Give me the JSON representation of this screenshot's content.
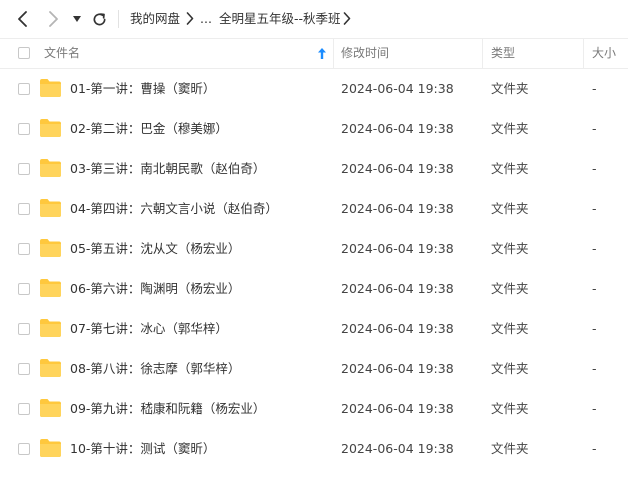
{
  "nav": {
    "back_icon": "chevron-left-icon",
    "forward_icon": "chevron-right-icon",
    "dropdown_icon": "caret-down-icon",
    "refresh_icon": "refresh-icon",
    "breadcrumb": {
      "root": "我的网盘",
      "ellipsis": "...",
      "current": "全明星五年级--秋季班"
    }
  },
  "columns": {
    "name": "文件名",
    "modified": "修改时间",
    "type": "类型",
    "size": "大小",
    "sort_icon": "sort-ascending-icon"
  },
  "accent_color": "#1a8cff",
  "folder_color": "#ffc83d",
  "files": [
    {
      "name": "01-第一讲：曹操（窦昕）",
      "modified": "2024-06-04 19:38",
      "type": "文件夹",
      "size": "-"
    },
    {
      "name": "02-第二讲：巴金（穆美娜）",
      "modified": "2024-06-04 19:38",
      "type": "文件夹",
      "size": "-"
    },
    {
      "name": "03-第三讲：南北朝民歌（赵伯奇）",
      "modified": "2024-06-04 19:38",
      "type": "文件夹",
      "size": "-"
    },
    {
      "name": "04-第四讲：六朝文言小说（赵伯奇）",
      "modified": "2024-06-04 19:38",
      "type": "文件夹",
      "size": "-"
    },
    {
      "name": "05-第五讲：沈从文（杨宏业）",
      "modified": "2024-06-04 19:38",
      "type": "文件夹",
      "size": "-"
    },
    {
      "name": "06-第六讲：陶渊明（杨宏业）",
      "modified": "2024-06-04 19:38",
      "type": "文件夹",
      "size": "-"
    },
    {
      "name": "07-第七讲：冰心（郭华梓）",
      "modified": "2024-06-04 19:38",
      "type": "文件夹",
      "size": "-"
    },
    {
      "name": "08-第八讲：徐志摩（郭华梓）",
      "modified": "2024-06-04 19:38",
      "type": "文件夹",
      "size": "-"
    },
    {
      "name": "09-第九讲：嵇康和阮籍（杨宏业）",
      "modified": "2024-06-04 19:38",
      "type": "文件夹",
      "size": "-"
    },
    {
      "name": "10-第十讲：测试（窦昕）",
      "modified": "2024-06-04 19:38",
      "type": "文件夹",
      "size": "-"
    }
  ]
}
